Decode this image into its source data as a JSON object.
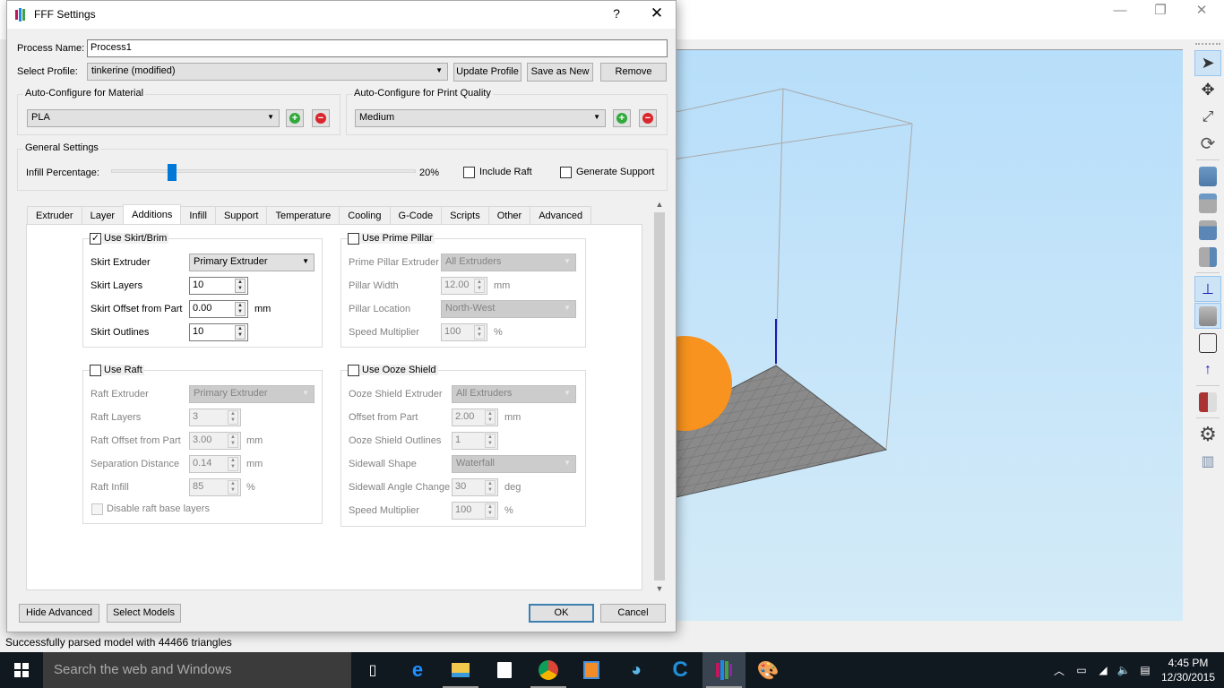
{
  "app": {
    "status": "Successfully parsed model with 44466 triangles",
    "window_controls": {
      "minimize": "—",
      "restore": "❐",
      "close": "✕"
    },
    "toolbar": [
      "select-arrow",
      "move",
      "scale",
      "rotate",
      "view-iso",
      "view-top",
      "view-front",
      "view-right",
      "axes",
      "solid-view",
      "wireframe-view",
      "normal",
      "section",
      "settings",
      "supports"
    ]
  },
  "dialog": {
    "title": "FFF Settings",
    "help": "?",
    "close": "✕",
    "process_name_label": "Process Name:",
    "process_name_value": "Process1",
    "select_profile_label": "Select Profile:",
    "select_profile_value": "tinkerine (modified)",
    "update_profile": "Update Profile",
    "save_as_new": "Save as New",
    "remove": "Remove",
    "material_group": "Auto-Configure for Material",
    "material_value": "PLA",
    "quality_group": "Auto-Configure for Print Quality",
    "quality_value": "Medium",
    "general_group": "General Settings",
    "infill_label": "Infill Percentage:",
    "infill_value": "20%",
    "infill_fraction": 0.2,
    "include_raft": "Include Raft",
    "include_raft_checked": false,
    "generate_support": "Generate Support",
    "generate_support_checked": false,
    "tabs": [
      "Extruder",
      "Layer",
      "Additions",
      "Infill",
      "Support",
      "Temperature",
      "Cooling",
      "G-Code",
      "Scripts",
      "Other",
      "Advanced"
    ],
    "active_tab": "Additions",
    "skirt": {
      "title": "Use Skirt/Brim",
      "checked": true,
      "extruder_label": "Skirt Extruder",
      "extruder_value": "Primary Extruder",
      "layers_label": "Skirt Layers",
      "layers_value": "10",
      "offset_label": "Skirt Offset from Part",
      "offset_value": "0.00",
      "offset_unit": "mm",
      "outlines_label": "Skirt Outlines",
      "outlines_value": "10"
    },
    "pillar": {
      "title": "Use Prime Pillar",
      "checked": false,
      "extruder_label": "Prime Pillar Extruder",
      "extruder_value": "All Extruders",
      "width_label": "Pillar Width",
      "width_value": "12.00",
      "width_unit": "mm",
      "location_label": "Pillar Location",
      "location_value": "North-West",
      "speed_label": "Speed Multiplier",
      "speed_value": "100",
      "speed_unit": "%"
    },
    "raft": {
      "title": "Use Raft",
      "checked": false,
      "extruder_label": "Raft Extruder",
      "extruder_value": "Primary Extruder",
      "layers_label": "Raft Layers",
      "layers_value": "3",
      "offset_label": "Raft Offset from Part",
      "offset_value": "3.00",
      "offset_unit": "mm",
      "separation_label": "Separation Distance",
      "separation_value": "0.14",
      "separation_unit": "mm",
      "infill_label": "Raft Infill",
      "infill_value": "85",
      "infill_unit": "%",
      "disable_base": "Disable raft base layers"
    },
    "ooze": {
      "title": "Use Ooze Shield",
      "checked": false,
      "extruder_label": "Ooze Shield Extruder",
      "extruder_value": "All Extruders",
      "offset_label": "Offset from Part",
      "offset_value": "2.00",
      "offset_unit": "mm",
      "outlines_label": "Ooze Shield Outlines",
      "outlines_value": "1",
      "shape_label": "Sidewall Shape",
      "shape_value": "Waterfall",
      "angle_label": "Sidewall Angle Change",
      "angle_value": "30",
      "angle_unit": "deg",
      "speed_label": "Speed Multiplier",
      "speed_value": "100",
      "speed_unit": "%"
    },
    "hide_advanced": "Hide Advanced",
    "select_models": "Select Models",
    "ok": "OK",
    "cancel": "Cancel"
  },
  "taskbar": {
    "search_placeholder": "Search the web and Windows",
    "apps": [
      "task-view",
      "edge",
      "file-explorer",
      "store",
      "chrome",
      "media-player",
      "app-bird",
      "app-c",
      "simplify3d",
      "paint"
    ],
    "time": "4:45 PM",
    "date": "12/30/2015"
  }
}
